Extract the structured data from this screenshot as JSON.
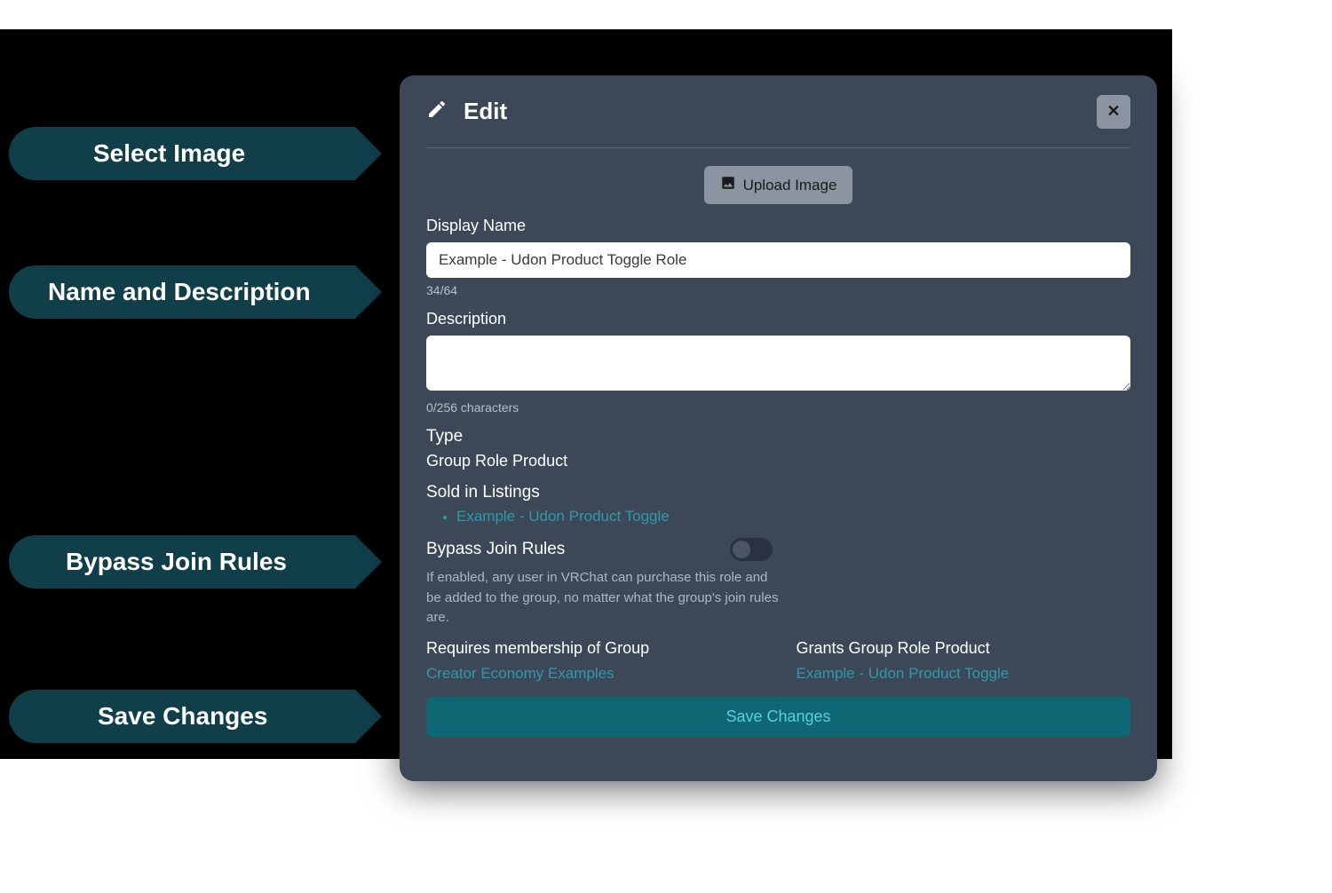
{
  "callouts": {
    "select_image": "Select Image",
    "name_desc": "Name and Description",
    "bypass": "Bypass Join Rules",
    "save": "Save Changes"
  },
  "dialog": {
    "title": "Edit",
    "close": "✕",
    "upload_button": "Upload Image",
    "display_name_label": "Display Name",
    "display_name_value": "Example - Udon Product Toggle Role",
    "display_name_counter": "34/64",
    "description_label": "Description",
    "description_value": "",
    "description_counter": "0/256 characters",
    "type_label": "Type",
    "type_value": "Group Role Product",
    "sold_in_label": "Sold in Listings",
    "sold_in_items": [
      "Example - Udon Product Toggle"
    ],
    "bypass_label": "Bypass Join Rules",
    "bypass_help": "If enabled, any user in VRChat can purchase this role and be added to the group, no matter what the group's join rules are.",
    "requires_label": "Requires membership of Group",
    "requires_link": "Creator Economy Examples",
    "grants_label": "Grants Group Role Product",
    "grants_link": "Example - Udon Product Toggle",
    "save_button": "Save Changes"
  }
}
